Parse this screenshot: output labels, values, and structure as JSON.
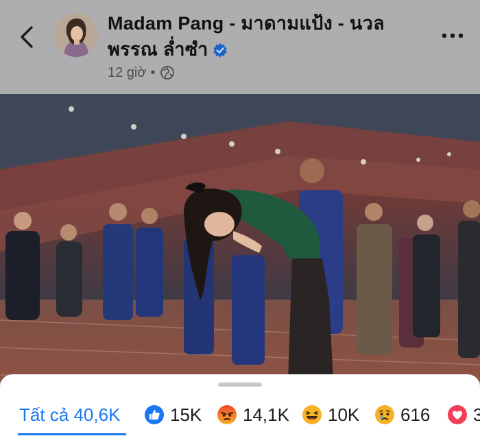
{
  "post": {
    "author": "Madam Pang - มาดามแป้ง - นวลพรรณ ล่ำซำ",
    "time": "12 giờ",
    "separator": "•"
  },
  "icons": {
    "back": "chevron-left-icon",
    "globe": "globe-icon",
    "verified": "verified-badge-icon",
    "more": "more-horizontal-icon"
  },
  "reactions": {
    "all": {
      "label": "Tất cả 40,6K"
    },
    "items": [
      {
        "type": "like",
        "icon": "like-icon",
        "count": "15K",
        "color": "#1877f2"
      },
      {
        "type": "angry",
        "icon": "angry-icon",
        "count": "14,1K",
        "color": "#e9710f"
      },
      {
        "type": "haha",
        "icon": "haha-icon",
        "count": "10K",
        "color": "#f7b125"
      },
      {
        "type": "sad",
        "icon": "sad-icon",
        "count": "616",
        "color": "#f7b125"
      },
      {
        "type": "love",
        "icon": "love-icon",
        "count": "3",
        "color": "#f33e58"
      }
    ]
  },
  "colors": {
    "accent": "#1877f2",
    "overlay_header": "#aeaeb0",
    "sheet": "#ffffff"
  }
}
